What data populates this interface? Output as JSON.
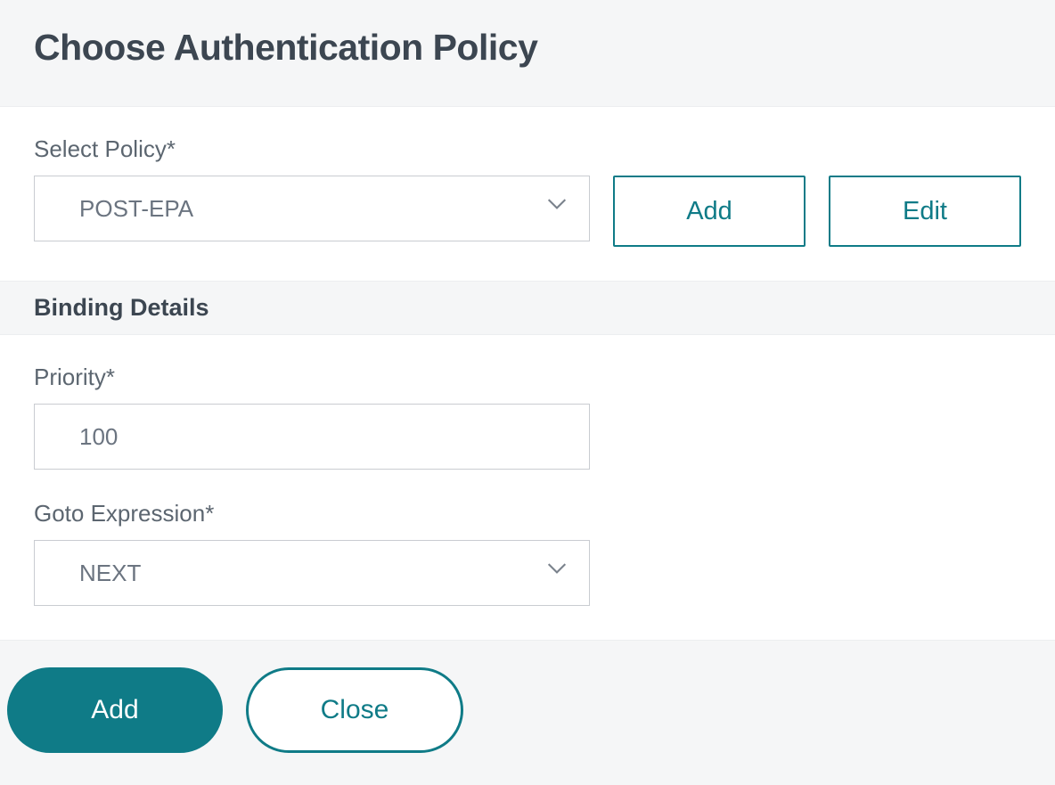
{
  "header": {
    "title": "Choose Authentication Policy"
  },
  "selectPolicy": {
    "label": "Select Policy*",
    "value": "POST-EPA",
    "addBtn": "Add",
    "editBtn": "Edit"
  },
  "bindingDetails": {
    "title": "Binding Details",
    "priority": {
      "label": "Priority*",
      "value": "100"
    },
    "gotoExpr": {
      "label": "Goto Expression*",
      "value": "NEXT"
    }
  },
  "footer": {
    "addBtn": "Add",
    "closeBtn": "Close"
  }
}
